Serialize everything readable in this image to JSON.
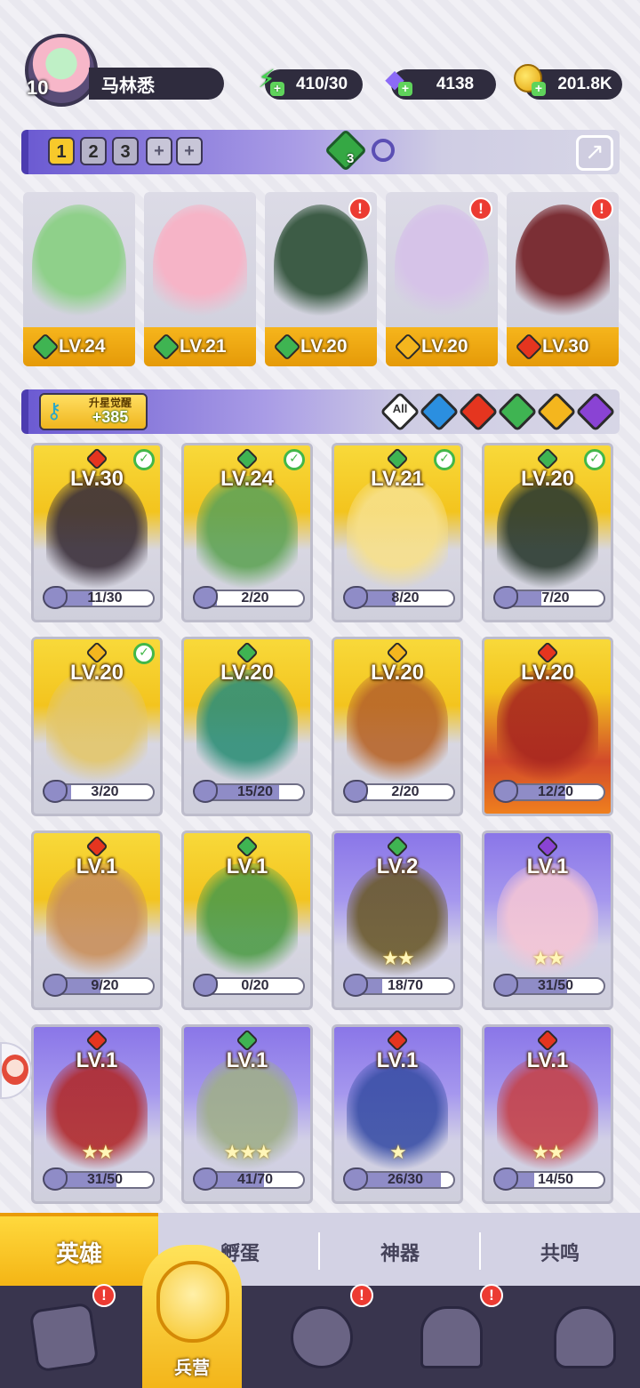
{
  "player": {
    "level": "10",
    "name": "马林悉"
  },
  "resources": {
    "energy": "410/30",
    "gems": "4138",
    "gold": "201.8K"
  },
  "team_bar": {
    "slots": [
      "1",
      "2",
      "3"
    ],
    "add_slot": "+",
    "badge_count": "3"
  },
  "team": [
    {
      "level": "LV.24",
      "element": "wind",
      "alert": false,
      "color": "#8fd08a"
    },
    {
      "level": "LV.21",
      "element": "wind",
      "alert": false,
      "color": "#f6b4c7"
    },
    {
      "level": "LV.20",
      "element": "wind",
      "alert": true,
      "color": "#3d5c46"
    },
    {
      "level": "LV.20",
      "element": "light",
      "alert": true,
      "color": "#d6c3e8"
    },
    {
      "level": "LV.30",
      "element": "fire",
      "alert": true,
      "color": "#7b2f35"
    }
  ],
  "awaken": {
    "title": "升星觉醒",
    "value": "+385"
  },
  "filters": {
    "all": "All",
    "elements": [
      "water",
      "fire",
      "wind",
      "light",
      "dark"
    ]
  },
  "heroes": [
    {
      "level": "LV.30",
      "element": "fire",
      "progress": "11/30",
      "fill": 0.37,
      "checked": true,
      "theme": "gold",
      "art": "#3a2f3a",
      "stars": ""
    },
    {
      "level": "LV.24",
      "element": "wind",
      "progress": "2/20",
      "fill": 0.1,
      "checked": true,
      "theme": "gold",
      "art": "#5fa356",
      "stars": ""
    },
    {
      "level": "LV.21",
      "element": "wind",
      "progress": "8/20",
      "fill": 0.4,
      "checked": true,
      "theme": "gold",
      "art": "#f7e08a",
      "stars": ""
    },
    {
      "level": "LV.20",
      "element": "wind",
      "progress": "7/20",
      "fill": 0.35,
      "checked": true,
      "theme": "gold",
      "art": "#2b3a30",
      "stars": ""
    },
    {
      "level": "LV.20",
      "element": "light",
      "progress": "3/20",
      "fill": 0.15,
      "checked": true,
      "theme": "gold",
      "art": "#e3c66a",
      "stars": ""
    },
    {
      "level": "LV.20",
      "element": "wind",
      "progress": "15/20",
      "fill": 0.75,
      "checked": false,
      "theme": "gold",
      "art": "#2f8f78",
      "stars": ""
    },
    {
      "level": "LV.20",
      "element": "light",
      "progress": "2/20",
      "fill": 0.1,
      "checked": false,
      "theme": "gold",
      "art": "#b7652a",
      "stars": ""
    },
    {
      "level": "LV.20",
      "element": "fire",
      "progress": "12/20",
      "fill": 0.6,
      "checked": false,
      "theme": "red",
      "art": "#a8271f",
      "stars": ""
    },
    {
      "level": "LV.1",
      "element": "fire",
      "progress": "9/20",
      "fill": 0.45,
      "checked": false,
      "theme": "gold",
      "art": "#c98f5a",
      "stars": ""
    },
    {
      "level": "LV.1",
      "element": "wind",
      "progress": "0/20",
      "fill": 0.0,
      "checked": false,
      "theme": "gold",
      "art": "#4f9c48",
      "stars": ""
    },
    {
      "level": "LV.2",
      "element": "wind",
      "progress": "18/70",
      "fill": 0.26,
      "checked": false,
      "theme": "purple",
      "art": "#6b5a2c",
      "stars": "★★"
    },
    {
      "level": "LV.1",
      "element": "dark",
      "progress": "31/50",
      "fill": 0.62,
      "checked": false,
      "theme": "purple",
      "art": "#f4c5d5",
      "stars": "★★"
    },
    {
      "level": "LV.1",
      "element": "fire",
      "progress": "31/50",
      "fill": 0.62,
      "checked": false,
      "theme": "purple",
      "art": "#b02a2c",
      "stars": "★★"
    },
    {
      "level": "LV.1",
      "element": "wind",
      "progress": "41/70",
      "fill": 0.59,
      "checked": false,
      "theme": "purple",
      "art": "#9fae8a",
      "stars": "★★★"
    },
    {
      "level": "LV.1",
      "element": "fire",
      "progress": "26/30",
      "fill": 0.87,
      "checked": false,
      "theme": "purple",
      "art": "#3a4fa6",
      "stars": "★"
    },
    {
      "level": "LV.1",
      "element": "fire",
      "progress": "14/50",
      "fill": 0.28,
      "checked": false,
      "theme": "purple",
      "art": "#c4424a",
      "stars": "★★"
    }
  ],
  "sub_tabs": [
    "英雄",
    "孵蛋",
    "神器",
    "共鸣"
  ],
  "nav": {
    "active_label": "兵营"
  },
  "colors": {
    "accent_gold": "#f3b51a",
    "accent_purple": "#6c5bd2",
    "nav_bg": "#39354e",
    "alert_red": "#ec3b32"
  }
}
